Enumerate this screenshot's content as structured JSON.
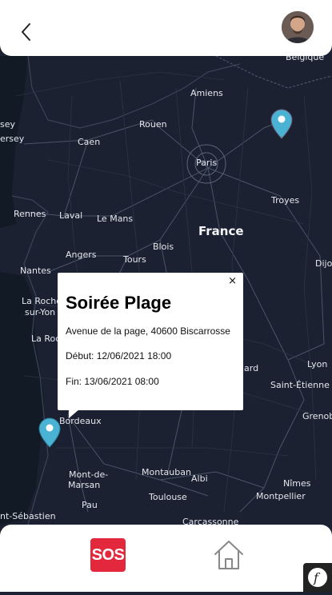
{
  "header": {
    "back_icon": "chevron-left-icon",
    "avatar": "user-avatar"
  },
  "map": {
    "cities": [
      {
        "id": "belgique",
        "name": "Belgique"
      },
      {
        "id": "amiens",
        "name": "Amiens"
      },
      {
        "id": "rouen",
        "name": "Rouen"
      },
      {
        "id": "caen",
        "name": "Caen"
      },
      {
        "id": "jersey1",
        "name": "sey"
      },
      {
        "id": "jersey2",
        "name": "ersey"
      },
      {
        "id": "paris",
        "name": "Paris"
      },
      {
        "id": "troyes",
        "name": "Troyes"
      },
      {
        "id": "rennes",
        "name": "Rennes"
      },
      {
        "id": "laval",
        "name": "Laval"
      },
      {
        "id": "lemans",
        "name": "Le Mans"
      },
      {
        "id": "france",
        "name": "France"
      },
      {
        "id": "blois",
        "name": "Blois"
      },
      {
        "id": "angers",
        "name": "Angers"
      },
      {
        "id": "tours",
        "name": "Tours"
      },
      {
        "id": "dijon",
        "name": "Dijo"
      },
      {
        "id": "nantes",
        "name": "Nantes"
      },
      {
        "id": "larochelle1",
        "name": "La Roche"
      },
      {
        "id": "larochelle2",
        "name": "sur-Yon"
      },
      {
        "id": "laroc",
        "name": "La Roc"
      },
      {
        "id": "ard",
        "name": "ard"
      },
      {
        "id": "lyon",
        "name": "Lyon"
      },
      {
        "id": "stetienne",
        "name": "Saint-Étienne"
      },
      {
        "id": "grenoble",
        "name": "Grenoble"
      },
      {
        "id": "bordeaux",
        "name": "Bordeaux"
      },
      {
        "id": "montdemarsan1",
        "name": "Mont-de-"
      },
      {
        "id": "montdemarsan2",
        "name": "Marsan"
      },
      {
        "id": "montauban",
        "name": "Montauban"
      },
      {
        "id": "albi",
        "name": "Albi"
      },
      {
        "id": "nimes",
        "name": "Nîmes"
      },
      {
        "id": "toulouse",
        "name": "Toulouse"
      },
      {
        "id": "montpellier",
        "name": "Montpellier"
      },
      {
        "id": "pau",
        "name": "Pau"
      },
      {
        "id": "stsebastien",
        "name": "nt-Sébastien"
      },
      {
        "id": "carcassonne",
        "name": "Carcassonne"
      }
    ]
  },
  "popup": {
    "title": "Soirée Plage",
    "address": "Avenue de la page, 40600 Biscarrosse",
    "start": "Début: 12/06/2021 18:00",
    "end": "Fin: 13/06/2021 08:00",
    "close_label": "×"
  },
  "footer": {
    "sos_label": "SOS",
    "home_icon": "home-icon"
  },
  "colors": {
    "sos": "#e3283e",
    "pin": "#4ab3d4",
    "map_bg": "#1b2130"
  }
}
